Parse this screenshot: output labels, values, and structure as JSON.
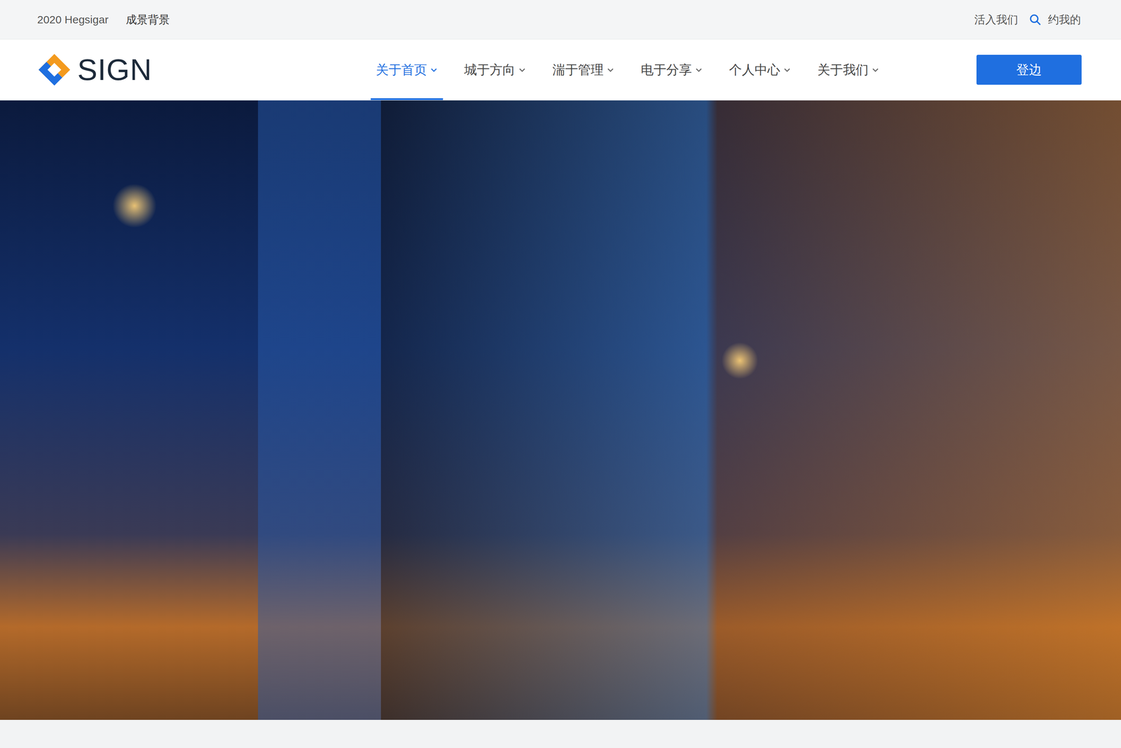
{
  "topbar": {
    "left": [
      "2020 Hegsigar",
      "成景背景"
    ],
    "join_link": "活入我们",
    "search_label": "约我的"
  },
  "logo": {
    "text": "SIGN"
  },
  "nav": {
    "items": [
      {
        "label": "关于首页",
        "selected": true
      },
      {
        "label": "城于方向",
        "selected": false
      },
      {
        "label": "湍于管理",
        "selected": false
      },
      {
        "label": "电于分享",
        "selected": false
      },
      {
        "label": "个人中心",
        "selected": false
      },
      {
        "label": "关于我们",
        "selected": false
      }
    ]
  },
  "login_button": "登边"
}
